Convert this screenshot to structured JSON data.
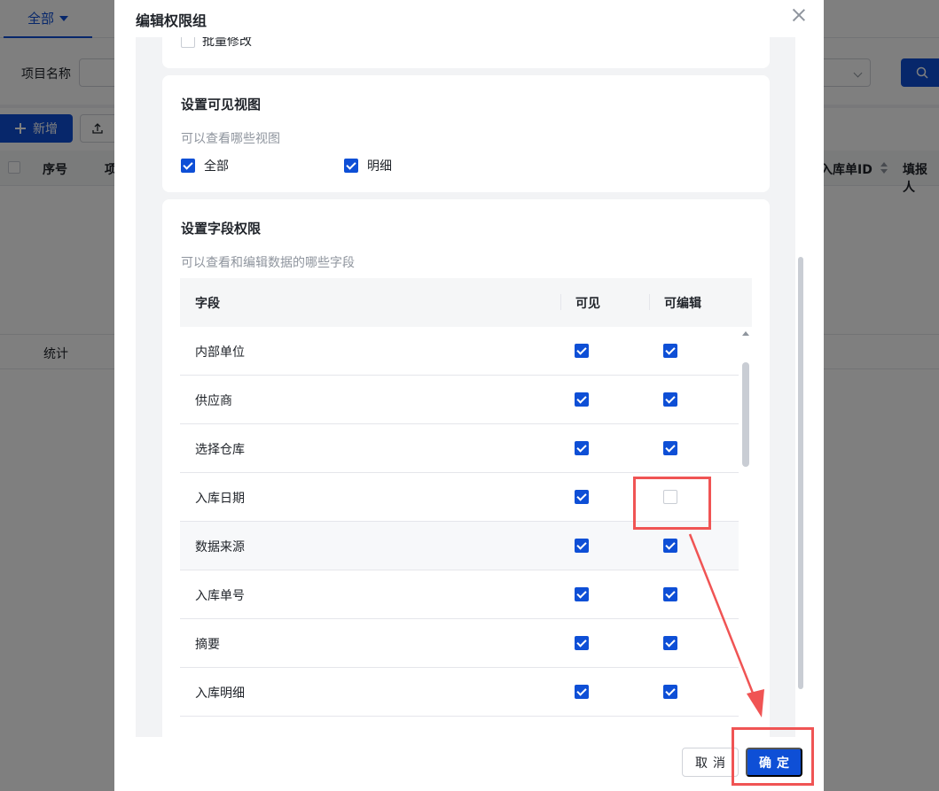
{
  "background": {
    "tab_label": "全部",
    "filter_label": "项目名称",
    "add_label": "新增",
    "columns": {
      "seq": "序号",
      "project": "项",
      "inbound_id": "入库单ID",
      "filler": "填报人"
    },
    "footer_label": "统计"
  },
  "modal": {
    "title": "编辑权限组",
    "bulk_label": "批量修改",
    "visible_views": {
      "title": "设置可见视图",
      "subtitle": "可以查看哪些视图",
      "options": [
        {
          "label": "全部",
          "checked": true
        },
        {
          "label": "明细",
          "checked": true
        }
      ]
    },
    "field_permissions": {
      "title": "设置字段权限",
      "subtitle": "可以查看和编辑数据的哪些字段",
      "headers": {
        "field": "字段",
        "visible": "可见",
        "editable": "可编辑"
      },
      "rows": [
        {
          "name": "内部单位",
          "visible": true,
          "editable": true
        },
        {
          "name": "供应商",
          "visible": true,
          "editable": true
        },
        {
          "name": "选择仓库",
          "visible": true,
          "editable": true
        },
        {
          "name": "入库日期",
          "visible": true,
          "editable": false
        },
        {
          "name": "数据来源",
          "visible": true,
          "editable": true
        },
        {
          "name": "入库单号",
          "visible": true,
          "editable": true
        },
        {
          "name": "摘要",
          "visible": true,
          "editable": true
        },
        {
          "name": "入库明细",
          "visible": true,
          "editable": true
        }
      ]
    },
    "cancel_label": "取消",
    "ok_label": "确定"
  },
  "colors": {
    "accent": "#0e4fd6",
    "annotation": "#f05454"
  }
}
